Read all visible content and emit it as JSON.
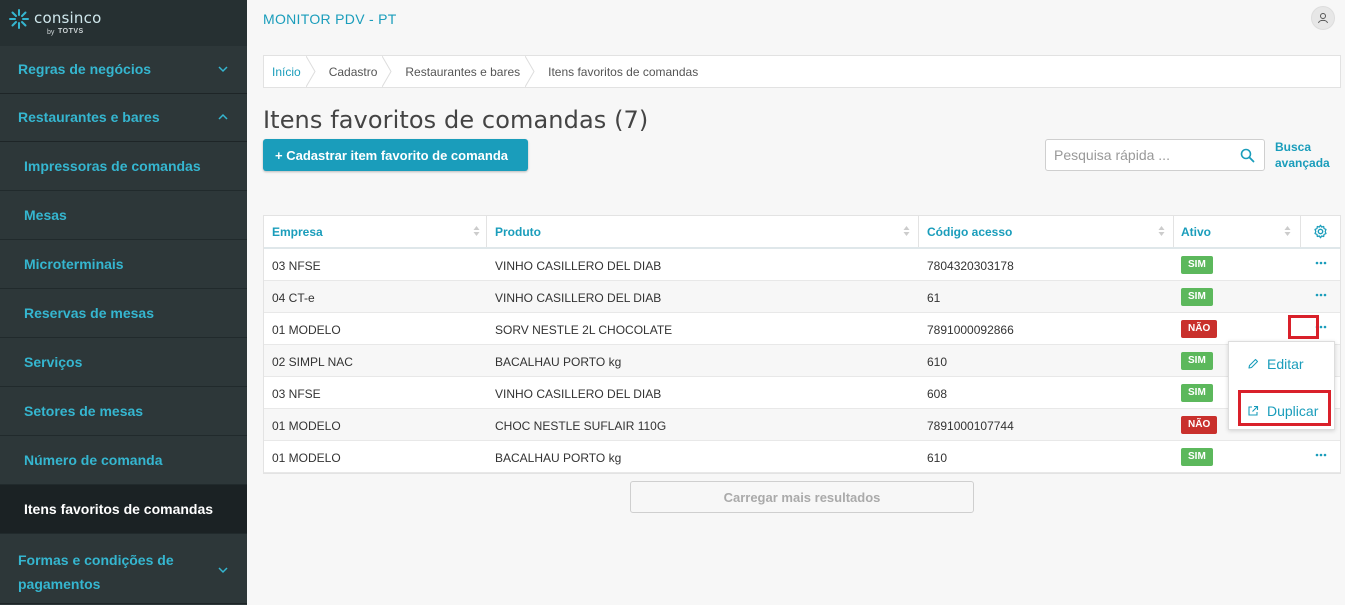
{
  "brand": {
    "name": "consinco",
    "by": "by",
    "totvs": "TOTVS"
  },
  "sidebar": {
    "groups": [
      {
        "label": "Regras de negócios"
      },
      {
        "label": "Restaurantes e bares"
      },
      {
        "label": "Formas e condições de pagamentos"
      }
    ],
    "items": [
      {
        "label": "Impressoras de comandas"
      },
      {
        "label": "Mesas"
      },
      {
        "label": "Microterminais"
      },
      {
        "label": "Reservas de mesas"
      },
      {
        "label": "Serviços"
      },
      {
        "label": "Setores de mesas"
      },
      {
        "label": "Número de comanda"
      },
      {
        "label": "Itens favoritos de comandas"
      }
    ]
  },
  "header": {
    "app_title": "MONITOR PDV - PT"
  },
  "breadcrumb": [
    "Início",
    "Cadastro",
    "Restaurantes e bares",
    "Itens favoritos de comandas"
  ],
  "page": {
    "title": "Itens favoritos de comandas (7)",
    "add_button": "+ Cadastrar item favorito de comanda",
    "search_placeholder": "Pesquisa rápida ...",
    "advanced_search_line1": "Busca",
    "advanced_search_line2": "avançada",
    "load_more": "Carregar mais resultados"
  },
  "table": {
    "columns": [
      "Empresa",
      "Produto",
      "Código acesso",
      "Ativo"
    ],
    "rows": [
      {
        "empresa": "03 NFSE",
        "produto": "VINHO CASILLERO DEL DIAB",
        "codigo": "7804320303178",
        "ativo": "SIM"
      },
      {
        "empresa": "04 CT-e",
        "produto": "VINHO CASILLERO DEL DIAB",
        "codigo": "61",
        "ativo": "SIM"
      },
      {
        "empresa": "01 MODELO",
        "produto": "SORV NESTLE 2L CHOCOLATE",
        "codigo": "7891000092866",
        "ativo": "NÃO"
      },
      {
        "empresa": "02 SIMPL NAC",
        "produto": "BACALHAU PORTO kg",
        "codigo": "610",
        "ativo": "SIM"
      },
      {
        "empresa": "03 NFSE",
        "produto": "VINHO CASILLERO DEL DIAB",
        "codigo": "608",
        "ativo": "SIM"
      },
      {
        "empresa": "01 MODELO",
        "produto": "CHOC NESTLE SUFLAIR 110G",
        "codigo": "7891000107744",
        "ativo": "NÃO"
      },
      {
        "empresa": "01 MODELO",
        "produto": "BACALHAU PORTO kg",
        "codigo": "610",
        "ativo": "SIM"
      }
    ]
  },
  "context_menu": {
    "edit": "Editar",
    "duplicate": "Duplicar"
  },
  "colors": {
    "accent": "#1a9dbb",
    "sidebar_bg": "#2d3739",
    "active_green": "#5cb85c",
    "inactive_red": "#c9302c",
    "highlight_red": "#d9202a"
  },
  "icons": [
    "chevron-down-icon",
    "chevron-up-icon",
    "user-icon",
    "search-icon",
    "sort-icon",
    "gear-icon",
    "more-dots-icon",
    "pencil-icon",
    "external-link-icon"
  ]
}
